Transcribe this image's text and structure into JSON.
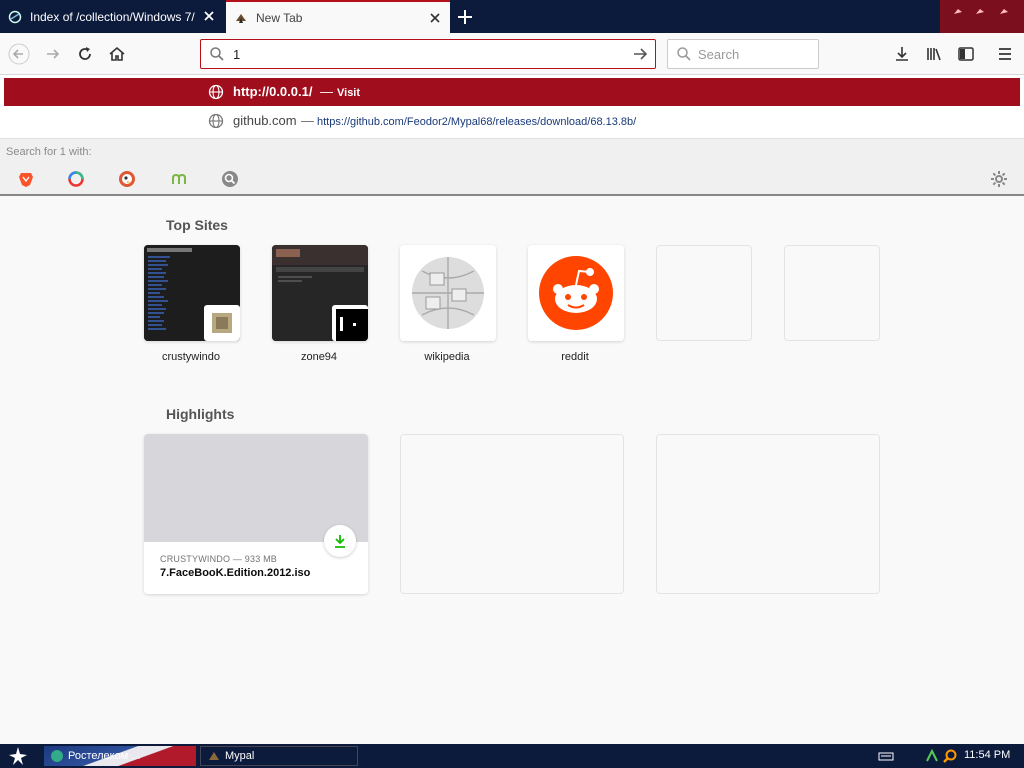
{
  "tabs": [
    {
      "title": "Index of /collection/Windows 7/",
      "active": false
    },
    {
      "title": "New Tab",
      "active": true
    }
  ],
  "urlbar": {
    "value": "1"
  },
  "searchbar": {
    "placeholder": "Search"
  },
  "dropdown": {
    "rows": [
      {
        "title": "http://0.0.0.1/",
        "sep": "—",
        "action": "Visit",
        "selected": true
      },
      {
        "title": "github.com",
        "sep": "—",
        "url": "https://github.com/Feodor2/Mypal68/releases/download/68.13.8b/"
      }
    ],
    "search_hint": "Search for 1 with:",
    "engines": [
      "brave-icon",
      "qwant-icon",
      "duckduckgo-icon",
      "mojeek-icon",
      "search-engine-icon"
    ]
  },
  "top_sites": {
    "title": "Top Sites",
    "items": [
      {
        "label": "crustywindo",
        "icon": "crustywindo-thumbnail"
      },
      {
        "label": "zone94",
        "icon": "zone94-thumbnail"
      },
      {
        "label": "wikipedia",
        "icon": "wikipedia-icon"
      },
      {
        "label": "reddit",
        "icon": "reddit-icon"
      },
      {
        "label": "",
        "icon": ""
      },
      {
        "label": "",
        "icon": ""
      }
    ]
  },
  "highlights": {
    "title": "Highlights",
    "cards": [
      {
        "meta": "CRUSTYWINDO — 933 MB",
        "title": "7.FaceBooK.Edition.2012.iso",
        "icon": "download-icon"
      },
      {
        "meta": "",
        "title": ""
      },
      {
        "meta": "",
        "title": ""
      }
    ]
  },
  "taskbar": {
    "tasks": [
      "Ростелеком ... ",
      "Mypal"
    ],
    "clock": "11:54 PM"
  },
  "colors": {
    "accent": "#b31019",
    "titlebar": "#0c1a3c",
    "highlight_row": "#a00d1c",
    "reddit": "#ff4500",
    "download": "#12bc00"
  }
}
